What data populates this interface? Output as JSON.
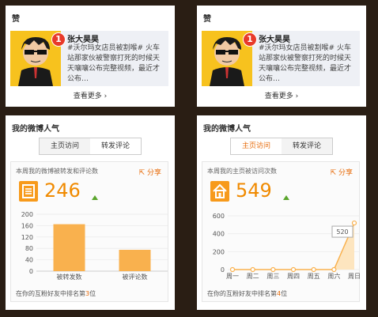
{
  "praise_cards": [
    {
      "title": "赞",
      "badge": "1",
      "name": "张大昊昊",
      "text": "#沃尔玛女店员被割喉# 火车站那家伙被警察打死的时候天天嚷嚷公布完整视频，最近才公布…",
      "more": "查看更多"
    },
    {
      "title": "赞",
      "badge": "1",
      "name": "张大昊昊",
      "text": "#沃尔玛女店员被割喉# 火车站那家伙被警察打死的时候天天嚷嚷公布完整视频，最近才公布…",
      "more": "查看更多"
    }
  ],
  "popularity_cards": [
    {
      "title": "我的微博人气",
      "tabs": [
        "主页访问",
        "转发评论"
      ],
      "active_tab": 1,
      "stat_label": "本周我的微博被转发和评论数",
      "share": "分享",
      "value": "246",
      "rank_prefix": "在你的互粉好友中排名第",
      "rank": "3",
      "rank_suffix": "位"
    },
    {
      "title": "我的微博人气",
      "tabs": [
        "主页访问",
        "转发评论"
      ],
      "active_tab": 0,
      "stat_label": "本周我的主页被访问次数",
      "share": "分享",
      "value": "549",
      "rank_prefix": "在你的互粉好友中排名第",
      "rank": "4",
      "rank_suffix": "位"
    }
  ],
  "chart_data": [
    {
      "type": "bar",
      "categories": [
        "被转发数",
        "被评论数"
      ],
      "values": [
        165,
        75
      ],
      "yticks": [
        0,
        40,
        80,
        120,
        160,
        200
      ],
      "ylim": [
        0,
        200
      ],
      "color": "#f9b14e"
    },
    {
      "type": "area",
      "categories": [
        "周一",
        "周二",
        "周三",
        "周四",
        "周五",
        "周六",
        "周日"
      ],
      "values": [
        0,
        0,
        0,
        0,
        0,
        0,
        520
      ],
      "yticks": [
        0,
        200,
        400,
        600
      ],
      "ylim": [
        0,
        600
      ],
      "annotation": "520",
      "color": "#f9b14e"
    }
  ]
}
